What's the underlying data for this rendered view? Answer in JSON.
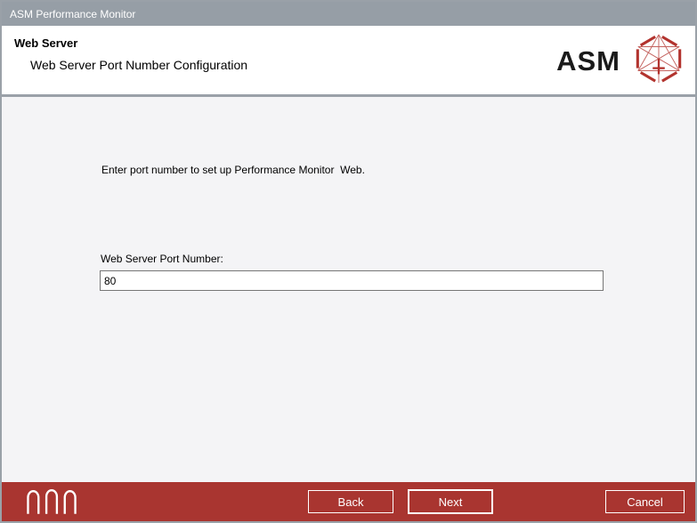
{
  "window": {
    "title": "ASM Performance Monitor"
  },
  "header": {
    "title": "Web Server",
    "subtitle": "Web Server Port Number Configuration",
    "logo_text": "ASM"
  },
  "content": {
    "instruction": "Enter port number to set up Performance Monitor  Web.",
    "port_label": "Web Server Port Number:",
    "port_value": "80"
  },
  "footer": {
    "back_label": "Back",
    "next_label": "Next",
    "cancel_label": "Cancel"
  },
  "colors": {
    "titlebar_gray": "#969EA6",
    "window_border_gray": "#9AA1A8",
    "content_bg": "#F4F4F6",
    "footer_red": "#A93530",
    "logo_red": "#B2332E",
    "input_border": "#767676"
  },
  "icons": {
    "logo_mark": "asm-polyhedron-icon",
    "footer_mark": "triple-arch-icon"
  }
}
